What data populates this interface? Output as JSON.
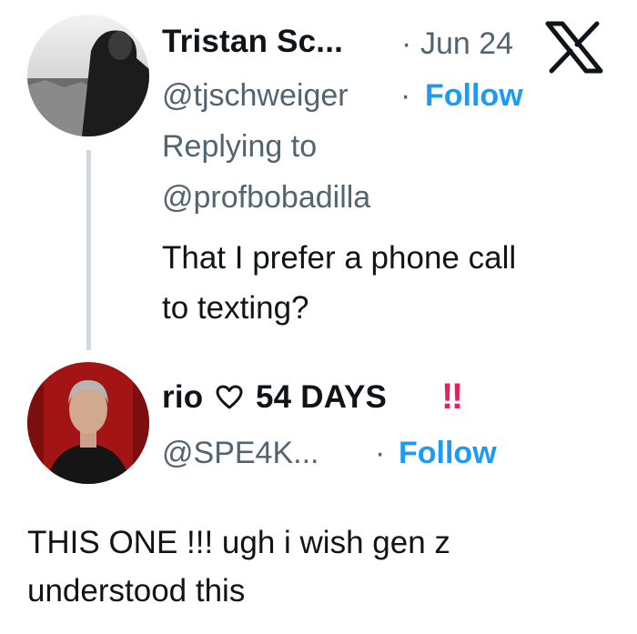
{
  "tweets": [
    {
      "display_name": "Tristan Sc...",
      "date": "Jun 24",
      "handle": "@tjschweiger",
      "follow_label": "Follow",
      "replying_to_label": "Replying to",
      "replying_to_handle": "@profbobadilla",
      "text": [
        "That I prefer a phone call",
        "to texting?"
      ]
    },
    {
      "display_name": "rio",
      "heart_icon": "heart-outline-icon",
      "name_suffix": "54 DAYS",
      "name_emoji": "‼",
      "handle": "@SPE4K...",
      "follow_label": "Follow",
      "text": [
        "THIS ONE !!! ugh i wish gen z",
        "understood this"
      ]
    }
  ],
  "separator": "·",
  "logo": "x-logo",
  "colors": {
    "text": "#0f1419",
    "muted": "#536471",
    "link": "#1d9bf0",
    "thread_line": "#cfd9de",
    "emoji": "#e0245e"
  }
}
